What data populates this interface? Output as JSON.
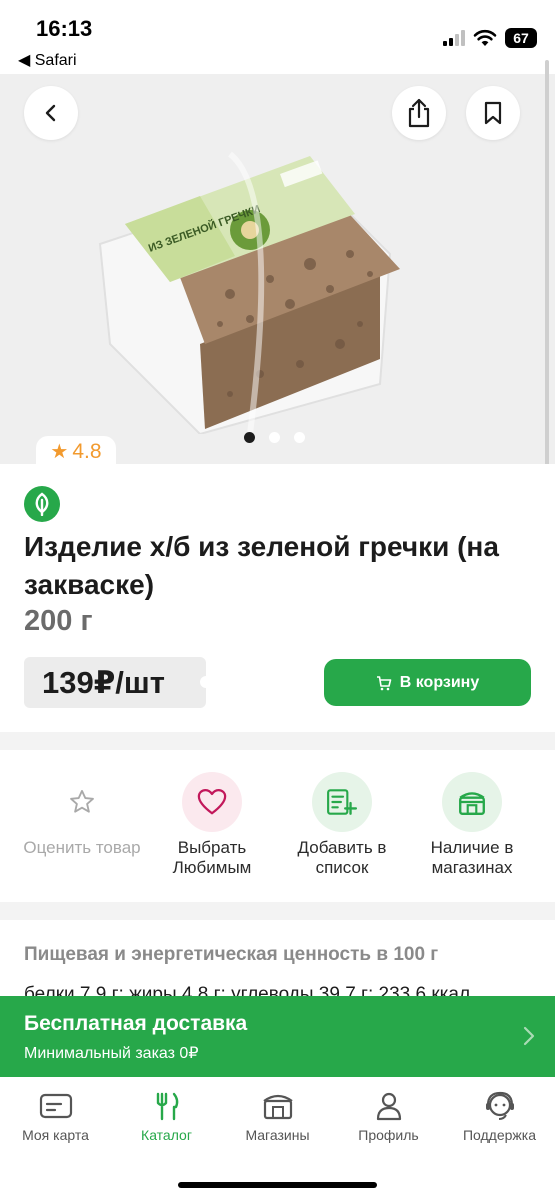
{
  "status_bar": {
    "time": "16:13",
    "back_app": "◀ Safari",
    "battery": "67"
  },
  "product": {
    "rating": "4.8",
    "title": "Изделие х/б из зеленой гречки (на закваске)",
    "weight": "200 г",
    "price": "139₽/шт",
    "cart_label": "В корзину",
    "image_dots": 3,
    "active_dot": 0,
    "package_text": "ИЗ ЗЕЛЕНОЙ ГРЕЧКИ"
  },
  "actions": [
    {
      "label": "Оценить товар",
      "icon": "star-icon"
    },
    {
      "label": "Выбрать Любимым",
      "icon": "heart-icon"
    },
    {
      "label": "Добавить в список",
      "icon": "add-to-list-icon"
    },
    {
      "label": "Наличие в магазинах",
      "icon": "store-icon"
    }
  ],
  "nutrition": {
    "title": "Пищевая и энергетическая ценность в 100 г",
    "values": "белки 7,9 г; жиры 4,8 г; углеводы 39,7 г; 233,6 ккал"
  },
  "delivery": {
    "title": "Бесплатная доставка",
    "subtitle": "Минимальный заказ  0₽"
  },
  "bottom_nav": [
    {
      "label": "Моя карта",
      "icon": "card-icon",
      "active": false
    },
    {
      "label": "Каталог",
      "icon": "catalog-icon",
      "active": true
    },
    {
      "label": "Магазины",
      "icon": "store-icon",
      "active": false
    },
    {
      "label": "Профиль",
      "icon": "profile-icon",
      "active": false
    },
    {
      "label": "Поддержка",
      "icon": "support-icon",
      "active": false
    }
  ],
  "colors": {
    "brand_green": "#27a84a",
    "rating_orange": "#f29a2e",
    "hero_background": "#efefef"
  }
}
